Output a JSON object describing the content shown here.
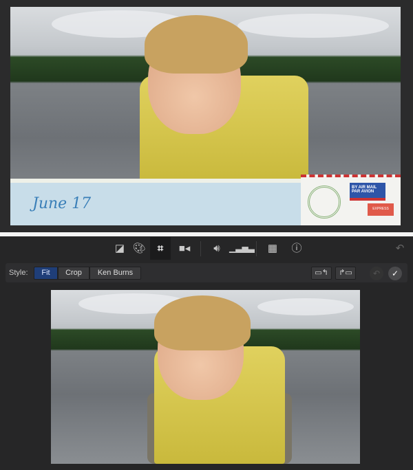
{
  "preview": {
    "title_card_text": "June 17",
    "stamp_text": "BY AIR MAIL",
    "stamp_subtext": "PAR AVION",
    "express_text": "EXPRESS"
  },
  "toolbar": {
    "icons": [
      "color-balance-icon",
      "color-correction-icon",
      "crop-icon",
      "stabilization-icon",
      "volume-icon",
      "equalizer-icon",
      "clip-filter-icon",
      "info-icon"
    ],
    "active": "crop-icon"
  },
  "style_row": {
    "label": "Style:",
    "options": [
      {
        "label": "Fit",
        "selected": true
      },
      {
        "label": "Crop",
        "selected": false
      },
      {
        "label": "Ken Burns",
        "selected": false
      }
    ],
    "accent": "#1f3e78"
  }
}
